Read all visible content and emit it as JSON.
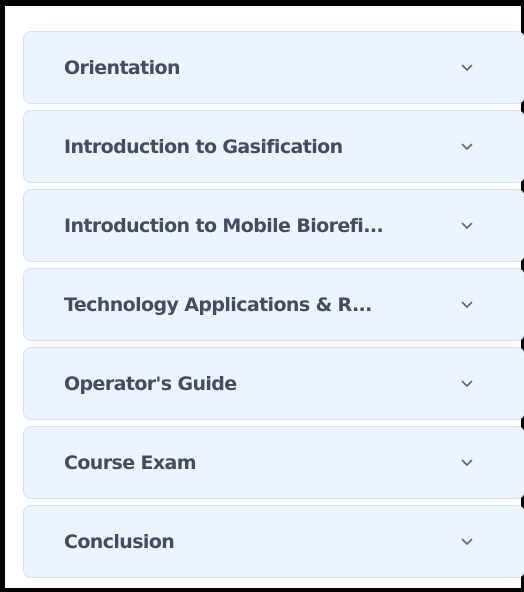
{
  "accordion": {
    "items": [
      {
        "label": "Orientation",
        "icon": "chevron-down-icon"
      },
      {
        "label": "Introduction to Gasification",
        "icon": "chevron-down-icon"
      },
      {
        "label": "Introduction to Mobile Biorefi...",
        "icon": "chevron-down-icon"
      },
      {
        "label": "Technology Applications & R...",
        "icon": "chevron-down-icon"
      },
      {
        "label": "Operator's Guide",
        "icon": "chevron-down-icon"
      },
      {
        "label": "Course Exam",
        "icon": "chevron-down-icon"
      },
      {
        "label": "Conclusion",
        "icon": "chevron-down-icon"
      }
    ]
  },
  "colors": {
    "item_background": "#edf4fd",
    "item_border": "#d3e1f2",
    "label_text": "#434c61",
    "frame": "#000000"
  }
}
